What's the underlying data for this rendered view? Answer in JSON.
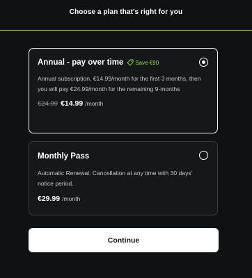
{
  "header": {
    "title": "Choose a plan that's right for you"
  },
  "colors": {
    "background": "#0f1214",
    "accent_line": "#c7cc43",
    "save_green": "#9bdb3a"
  },
  "plans": [
    {
      "title": "Annual - pay over time",
      "badge_icon": "tag-icon",
      "badge": "Save €90",
      "description": "Annual subscription. €14.99/month for the first 3 months, then you will pay €24.99/month for the remaining 9-months",
      "old_price": "€24.99",
      "price": "€14.99",
      "period": "/month",
      "selected": true
    },
    {
      "title": "Monthly Pass",
      "description": "Automatic Renewal. Cancellation at any time with 30 days' notice period.",
      "price": "€29.99",
      "period": "/month",
      "selected": false
    }
  ],
  "continue_label": "Continue"
}
